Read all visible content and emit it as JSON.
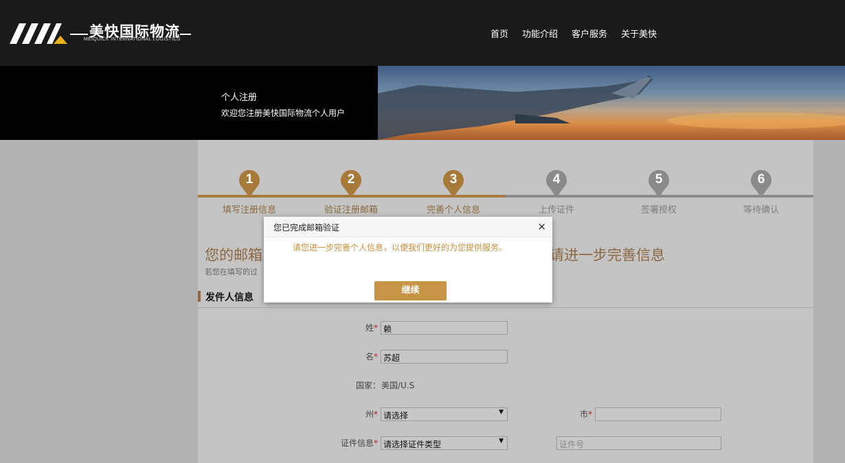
{
  "logo": {
    "name_cn": "美快国际物流",
    "name_en": "MEIQUICK INTERNATIONAL LOGISTICS"
  },
  "nav": [
    "首页",
    "功能介绍",
    "客户服务",
    "关于美快"
  ],
  "banner": {
    "title": "个人注册",
    "subtitle": "欢迎您注册美快国际物流个人用户"
  },
  "steps": [
    {
      "num": "1",
      "label": "填写注册信息",
      "status": "done"
    },
    {
      "num": "2",
      "label": "验证注册邮箱",
      "status": "done"
    },
    {
      "num": "3",
      "label": "完善个人信息",
      "status": "done"
    },
    {
      "num": "4",
      "label": "上传证件",
      "status": "todo"
    },
    {
      "num": "5",
      "label": "签署授权",
      "status": "todo"
    },
    {
      "num": "6",
      "label": "等待确认",
      "status": "todo"
    }
  ],
  "page": {
    "heading_left": "您的邮箱",
    "heading_right": "请进一步完善信息",
    "note": "若您在填写的过"
  },
  "section": {
    "title": "发件人信息"
  },
  "form": {
    "surname_label": "姓",
    "surname_value": "赖",
    "given_label": "名",
    "given_value": "苏超",
    "country_label": "国家：",
    "country_value": "美国/U.S",
    "state_label": "州",
    "state_value": "请选择",
    "city_label": "市",
    "city_value": "",
    "id_label": "证件信息",
    "id_type_value": "请选择证件类型",
    "id_number_placeholder": "证件号",
    "required_mark": "*"
  },
  "dialog": {
    "title": "您已完成邮箱验证",
    "close": "×",
    "message": "请您进一步完善个人信息，以便我们更好的为您提供服务。",
    "button": "继续"
  },
  "colors": {
    "accent": "#c89446",
    "header_bg": "#1a1a1a",
    "step_done": "#a77a3a",
    "step_todo": "#8a8a8a"
  }
}
